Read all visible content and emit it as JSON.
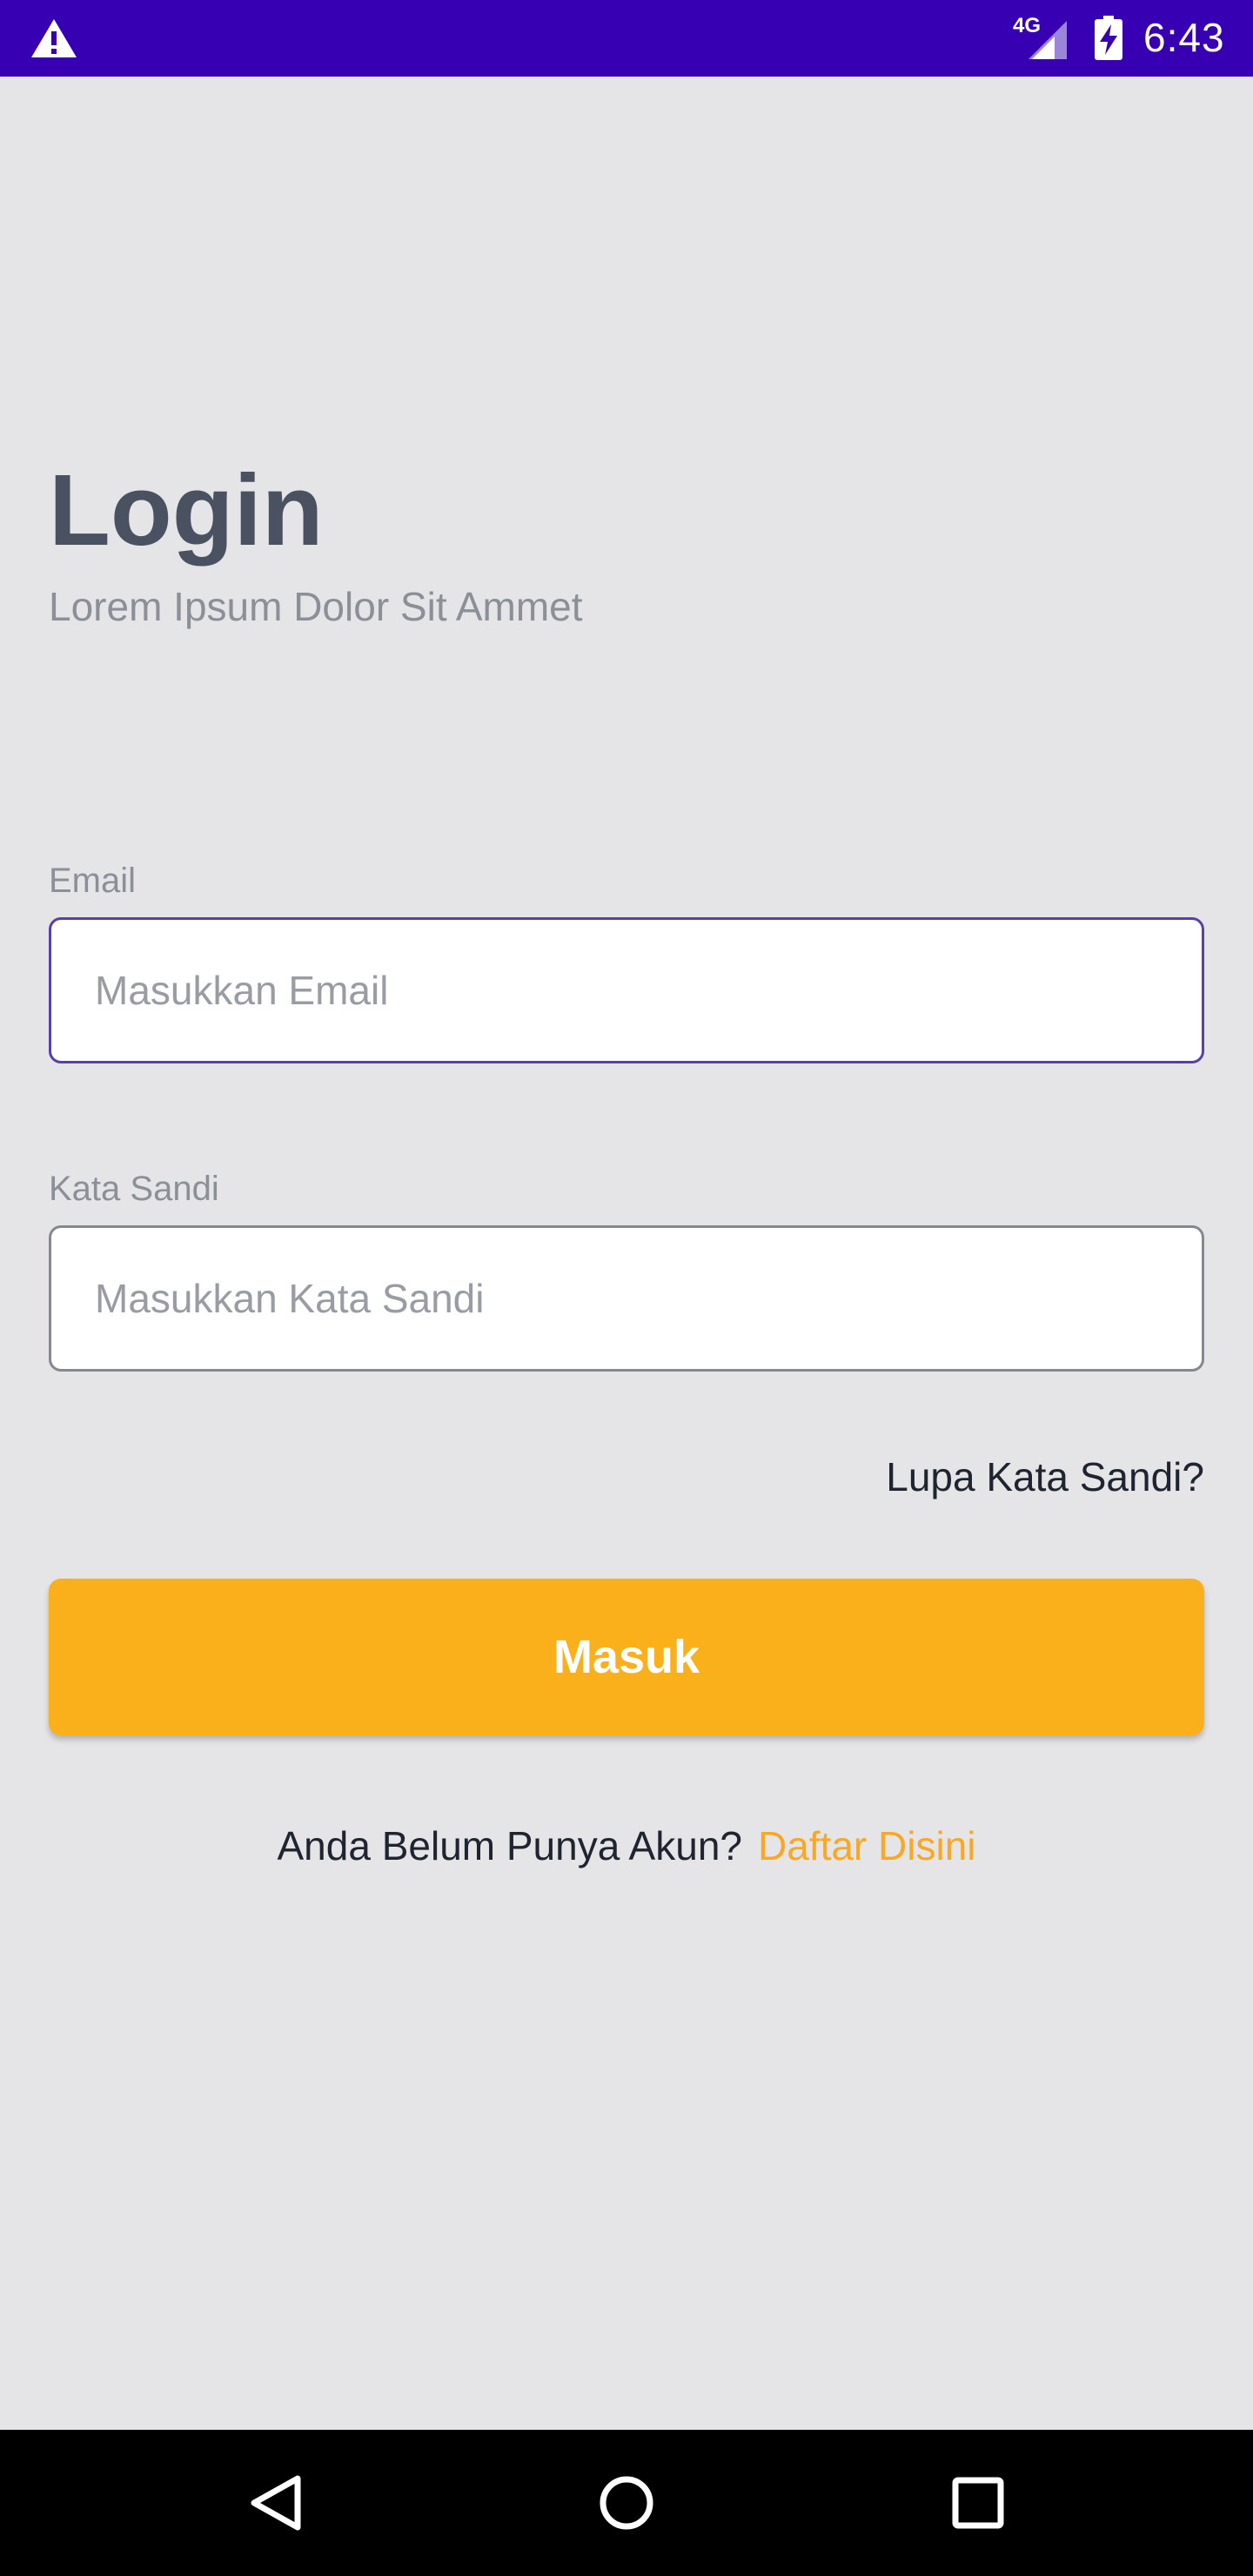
{
  "status_bar": {
    "network_label": "4G",
    "time": "6:43",
    "background_color": "#3700b3",
    "icons": [
      "warning-icon",
      "signal-icon",
      "battery-charging-icon"
    ]
  },
  "header": {
    "title": "Login",
    "subtitle": "Lorem Ipsum Dolor Sit Ammet"
  },
  "form": {
    "email": {
      "label": "Email",
      "placeholder": "Masukkan Email",
      "value": ""
    },
    "password": {
      "label": "Kata Sandi",
      "placeholder": "Masukkan Kata Sandi",
      "value": ""
    },
    "forgot_password": "Lupa Kata Sandi?",
    "submit_label": "Masuk"
  },
  "register": {
    "prompt": "Anda Belum Punya Akun?",
    "link": "Daftar Disini"
  },
  "colors": {
    "accent": "#f9b01b",
    "link_accent": "#f9a825",
    "focus_border": "#5a3fa6",
    "background": "#e5e5e7"
  },
  "nav_bar": {
    "icons": [
      "back-icon",
      "home-icon",
      "recents-icon"
    ]
  }
}
